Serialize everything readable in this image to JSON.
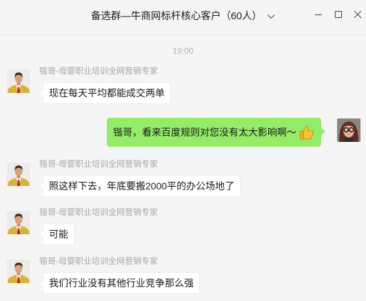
{
  "window": {
    "title": "备选群—牛商网标杆核心客户（60人）"
  },
  "chat": {
    "timestamp": "19:00",
    "messages": [
      {
        "sender": "锴哥-母婴职业培训全网营销专家",
        "text": "现在每天平均都能成交两单"
      },
      {
        "text": "锴哥，看来百度规则对您没有太大影响啊～",
        "emoji": "thumbs-up-icon"
      },
      {
        "sender": "锴哥-母婴职业培训全网营销专家",
        "text": "照这样下去，年底要搬2000平的办公场地了"
      },
      {
        "sender": "锴哥-母婴职业培训全网营销专家",
        "text": "可能"
      },
      {
        "sender": "锴哥-母婴职业培训全网营销专家",
        "text": "我们行业没有其他行业竞争那么强"
      }
    ]
  },
  "icons": {
    "title_dropdown": "chevron-down-icon",
    "minimize": "minimize-icon",
    "maximize": "maximize-icon",
    "close": "close-icon"
  },
  "colors": {
    "background": "#f5f5f5",
    "bubble_self": "#95ec69",
    "bubble_other": "#ffffff",
    "muted_text": "#b2b2b2"
  }
}
